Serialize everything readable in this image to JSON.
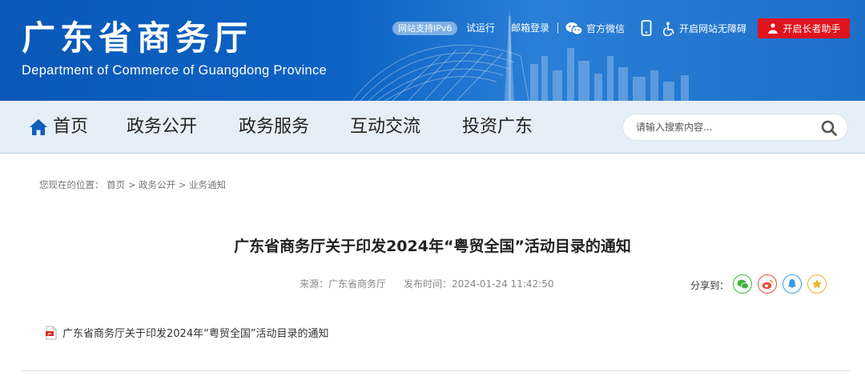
{
  "header": {
    "site_title": "广东省商务厅",
    "site_subtitle": "Department of Commerce of Guangdong Province",
    "ipv6_badge": "网站支持IPv6",
    "links": {
      "trial_run": "试运行",
      "mailbox_login": "邮箱登录",
      "official_wechat": "官方微信",
      "accessibility": "开启网站无障碍",
      "elder_assistant": "开启长者助手"
    },
    "brand_color": "#0d63c4",
    "elder_button_color": "#e0141d"
  },
  "nav": {
    "items": [
      "首页",
      "政务公开",
      "政务服务",
      "互动交流",
      "投资广东"
    ],
    "search_placeholder": "请输入搜索内容..."
  },
  "breadcrumb": {
    "prefix": "您现在的位置：",
    "items": [
      "首页",
      "政务公开",
      "业务通知"
    ],
    "separator": ">"
  },
  "article": {
    "title": "广东省商务厅关于印发2024年“粤贸全国”活动目录的通知",
    "source": "来源：广东省商务厅",
    "publish_time": "发布时间：2024-01-24 11:42:50",
    "share_label": "分享到：",
    "share_icons": [
      "wechat-share-icon",
      "weibo-share-icon",
      "qq-share-icon",
      "qzone-share-icon"
    ],
    "attachment_label": "广东省商务厅关于印发2024年“粤贸全国”活动目录的通知",
    "attachment_icon": "pdf-icon"
  }
}
